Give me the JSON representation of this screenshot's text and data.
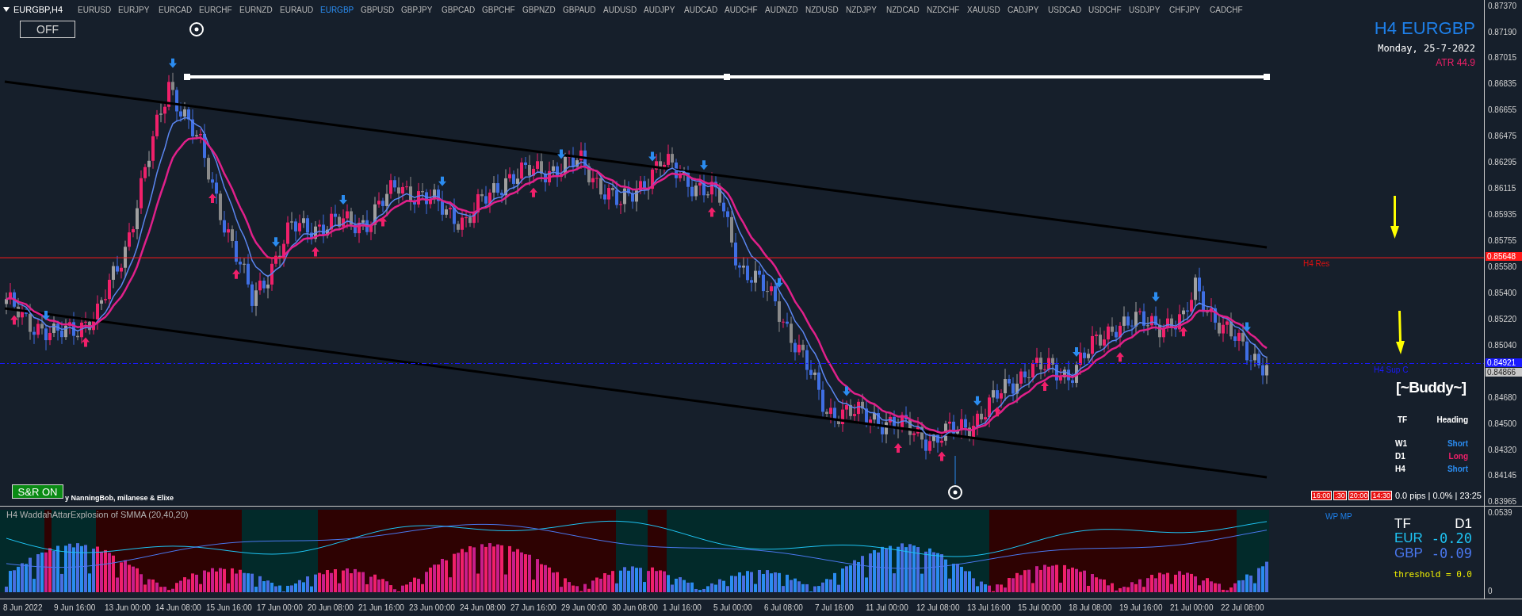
{
  "chart_header": {
    "symbol": "EURGBP,H4"
  },
  "symbol_bar": [
    {
      "label": "EURUSD",
      "selected": false
    },
    {
      "label": "EURJPY",
      "selected": false
    },
    {
      "label": "EURCAD",
      "selected": false
    },
    {
      "label": "EURCHF",
      "selected": false
    },
    {
      "label": "EURNZD",
      "selected": false
    },
    {
      "label": "EURAUD",
      "selected": false
    },
    {
      "label": "EURGBP",
      "selected": true
    },
    {
      "label": "GBPUSD",
      "selected": false
    },
    {
      "label": "GBPJPY",
      "selected": false
    },
    {
      "label": "GBPCAD",
      "selected": false
    },
    {
      "label": "GBPCHF",
      "selected": false
    },
    {
      "label": "GBPNZD",
      "selected": false
    },
    {
      "label": "GBPAUD",
      "selected": false
    },
    {
      "label": "AUDUSD",
      "selected": false
    },
    {
      "label": "AUDJPY",
      "selected": false
    },
    {
      "label": "AUDCAD",
      "selected": false
    },
    {
      "label": "AUDCHF",
      "selected": false
    },
    {
      "label": "AUDNZD",
      "selected": false
    },
    {
      "label": "NZDUSD",
      "selected": false
    },
    {
      "label": "NZDJPY",
      "selected": false
    },
    {
      "label": "NZDCAD",
      "selected": false
    },
    {
      "label": "NZDCHF",
      "selected": false
    },
    {
      "label": "XAUUSD",
      "selected": false
    },
    {
      "label": "CADJPY",
      "selected": false
    },
    {
      "label": "USDCAD",
      "selected": false
    },
    {
      "label": "USDCHF",
      "selected": false
    },
    {
      "label": "USDJPY",
      "selected": false
    },
    {
      "label": "CHFJPY",
      "selected": false
    },
    {
      "label": "CADCHF",
      "selected": false
    }
  ],
  "toggle_button": {
    "label": "OFF"
  },
  "info": {
    "title": "H4 EURGBP",
    "date": "Monday, 25-7-2022",
    "atr": "ATR 44.9"
  },
  "levels": [
    {
      "label": "H4 Res",
      "price": "0.85648",
      "kind": "resistance"
    },
    {
      "label": "H4 Sup C",
      "price": "0.84921",
      "kind": "support"
    }
  ],
  "price_axis": {
    "ticks": [
      "0.87370",
      "0.87190",
      "0.87015",
      "0.86835",
      "0.86655",
      "0.86475",
      "0.86295",
      "0.86115",
      "0.85935",
      "0.85755",
      "0.85580",
      "0.85400",
      "0.85220",
      "0.85040",
      "0.84680",
      "0.84500",
      "0.84320",
      "0.84145",
      "0.83965"
    ],
    "bid": "0.84866"
  },
  "buddy": {
    "title": "[~Buddy~]",
    "columns": [
      "TF",
      "Heading"
    ],
    "rows": [
      {
        "tf": "W1",
        "heading": "Short",
        "kind": "short"
      },
      {
        "tf": "D1",
        "heading": "Long",
        "kind": "long"
      },
      {
        "tf": "H4",
        "heading": "Short",
        "kind": "short"
      }
    ]
  },
  "session_tags": [
    "16:00",
    ":30",
    "20:00",
    "14:30"
  ],
  "status": "0.0 pips | 0.0% | 23:25",
  "sr_button": {
    "label": "S&R ON",
    "on": true
  },
  "credit": "y NanningBob, milanese & Elixe",
  "indicator": {
    "title": "H4 WaddahAttarExplosion of SMMA (20,40,20)",
    "legend": "WP MP",
    "axis": [
      "0.0539",
      "0"
    ],
    "panel": {
      "tf_label": "TF",
      "tf": "D1",
      "rows": [
        {
          "currency": "EUR",
          "value": "-0.20",
          "color": "#1ec4f4"
        },
        {
          "currency": "GBP",
          "value": "-0.09",
          "color": "#4a78f0"
        }
      ],
      "threshold": "threshold = 0.0"
    }
  },
  "time_axis": [
    "8 Jun 2022",
    "9 Jun 16:00",
    "13 Jun 00:00",
    "14 Jun 08:00",
    "15 Jun 16:00",
    "17 Jun 00:00",
    "20 Jun 08:00",
    "21 Jun 16:00",
    "23 Jun 00:00",
    "24 Jun 08:00",
    "27 Jun 16:00",
    "29 Jun 00:00",
    "30 Jun 08:00",
    "1 Jul 16:00",
    "5 Jul 00:00",
    "6 Jul 08:00",
    "7 Jul 16:00",
    "11 Jul 00:00",
    "12 Jul 08:00",
    "13 Jul 16:00",
    "15 Jul 00:00",
    "18 Jul 08:00",
    "19 Jul 16:00",
    "21 Jul 00:00",
    "22 Jul 08:00"
  ]
}
